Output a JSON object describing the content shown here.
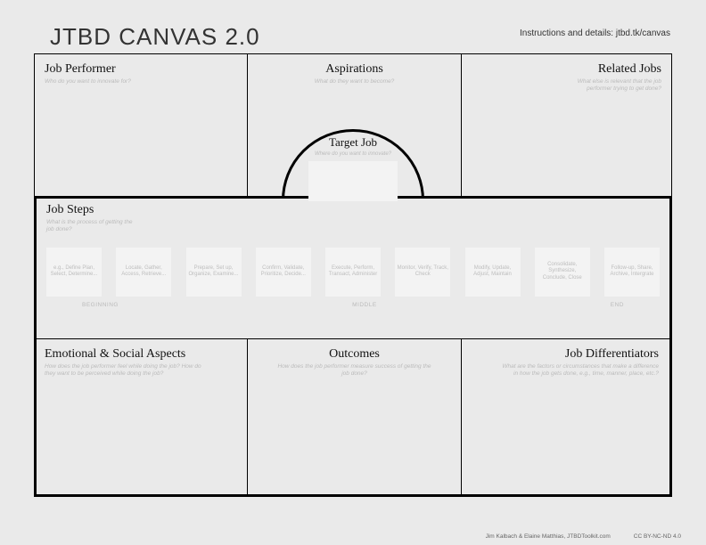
{
  "header": {
    "title": "JTBD CANVAS 2.0",
    "instructions": "Instructions and details: jtbd.tk/canvas"
  },
  "top": {
    "performer": {
      "title": "Job Performer",
      "sub": "Who do you want to innovate for?"
    },
    "aspirations": {
      "title": "Aspirations",
      "sub": "What do they want to become?"
    },
    "related": {
      "title": "Related Jobs",
      "sub": "What else is relevant that the job performer trying to get done?"
    }
  },
  "target": {
    "title": "Target Job",
    "sub": "Where do you want to innovate?"
  },
  "steps": {
    "title": "Job Steps",
    "sub": "What is the process of getting the job done?",
    "cards": [
      "e.g., Define Plan, Select, Determine...",
      "Locate, Gather, Access, Retrieve...",
      "Prepare, Set up, Organize, Examine...",
      "Confirm, Validate, Prioritize, Decide...",
      "Execute, Perform, Transact, Administer",
      "Monitor, Verify, Track, Check",
      "Modify, Update, Adjust, Maintain",
      "Consolidate, Synthesize, Conclude, Close",
      "Follow-up, Share, Archive, Intergrate"
    ],
    "phases": {
      "beginning": "BEGINNING",
      "middle": "MIDDLE",
      "end": "END"
    }
  },
  "bottom": {
    "emotional": {
      "title": "Emotional & Social Aspects",
      "sub": "How does the job performer feel while doing the job? How do they want to be perceived while doing the job?"
    },
    "outcomes": {
      "title": "Outcomes",
      "sub": "How does the job performer measure success of getting the job done?"
    },
    "differentiators": {
      "title": "Job Differentiators",
      "sub": "What are the factors or circumstances that make a difference in how the job gets done, e.g., time, manner, place, etc.?"
    }
  },
  "footer": {
    "credit": "Jim Kalbach & Elaine Matthias, JTBDToolkit.com",
    "license": "CC BY-NC-ND 4.0"
  }
}
